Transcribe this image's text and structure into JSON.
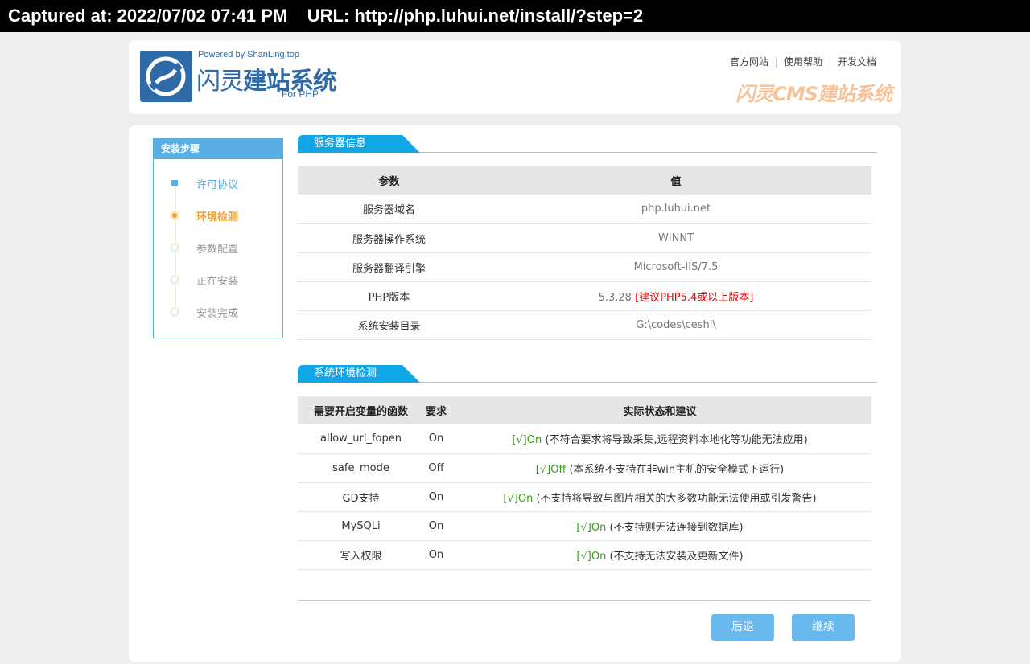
{
  "capture_bar": {
    "captured_label": "Captured at: 2022/07/02 07:41 PM",
    "url_label": "URL: http://php.luhui.net/install/?step=2"
  },
  "header": {
    "powered": "Powered by ShanLing.top",
    "brand_part1": "闪灵",
    "brand_part2": "建站系统",
    "for_php": "For PHP",
    "links": [
      "官方网站",
      "使用帮助",
      "开发文档"
    ],
    "slogan": "闪灵CMS建站系统"
  },
  "steps": {
    "title": "安装步骤",
    "items": [
      {
        "label": "许可协议",
        "state": "done"
      },
      {
        "label": "环境检测",
        "state": "current"
      },
      {
        "label": "参数配置",
        "state": "todo"
      },
      {
        "label": "正在安装",
        "state": "todo"
      },
      {
        "label": "安装完成",
        "state": "todo"
      }
    ]
  },
  "server_info": {
    "section_title": "服务器信息",
    "headers": [
      "参数",
      "值"
    ],
    "rows": [
      {
        "param": "服务器域名",
        "value": "php.luhui.net",
        "note": ""
      },
      {
        "param": "服务器操作系统",
        "value": "WINNT",
        "note": ""
      },
      {
        "param": "服务器翻译引擎",
        "value": "Microsoft-IIS/7.5",
        "note": ""
      },
      {
        "param": "PHP版本",
        "value": "5.3.28",
        "note": "[建议PHP5.4或以上版本]"
      },
      {
        "param": "系统安装目录",
        "value": "G:\\codes\\ceshi\\",
        "note": ""
      }
    ]
  },
  "env_check": {
    "section_title": "系统环境检测",
    "headers": [
      "需要开启变量的函数",
      "要求",
      "实际状态和建议"
    ],
    "rows": [
      {
        "name": "allow_url_fopen",
        "required": "On",
        "status": "[√]On",
        "advice": " (不符合要求将导致采集,远程资料本地化等功能无法应用)"
      },
      {
        "name": "safe_mode",
        "required": "Off",
        "status": "[√]Off",
        "advice": " (本系统不支持在非win主机的安全模式下运行)"
      },
      {
        "name": "GD支持",
        "required": "On",
        "status": "[√]On",
        "advice": " (不支持将导致与图片相关的大多数功能无法使用或引发警告)"
      },
      {
        "name": "MySQLi",
        "required": "On",
        "status": "[√]On",
        "advice": " (不支持则无法连接到数据库)"
      },
      {
        "name": "写入权限",
        "required": "On",
        "status": "[√]On",
        "advice": " (不支持无法安装及更新文件)"
      }
    ]
  },
  "buttons": {
    "back": "后退",
    "continue": "继续"
  },
  "colors": {
    "accent": "#5aaee5",
    "tab": "#11a6e6",
    "button": "#69b8ee",
    "current_step": "#f0a030",
    "ok": "#3a9a1a",
    "warning": "#ee0000"
  }
}
